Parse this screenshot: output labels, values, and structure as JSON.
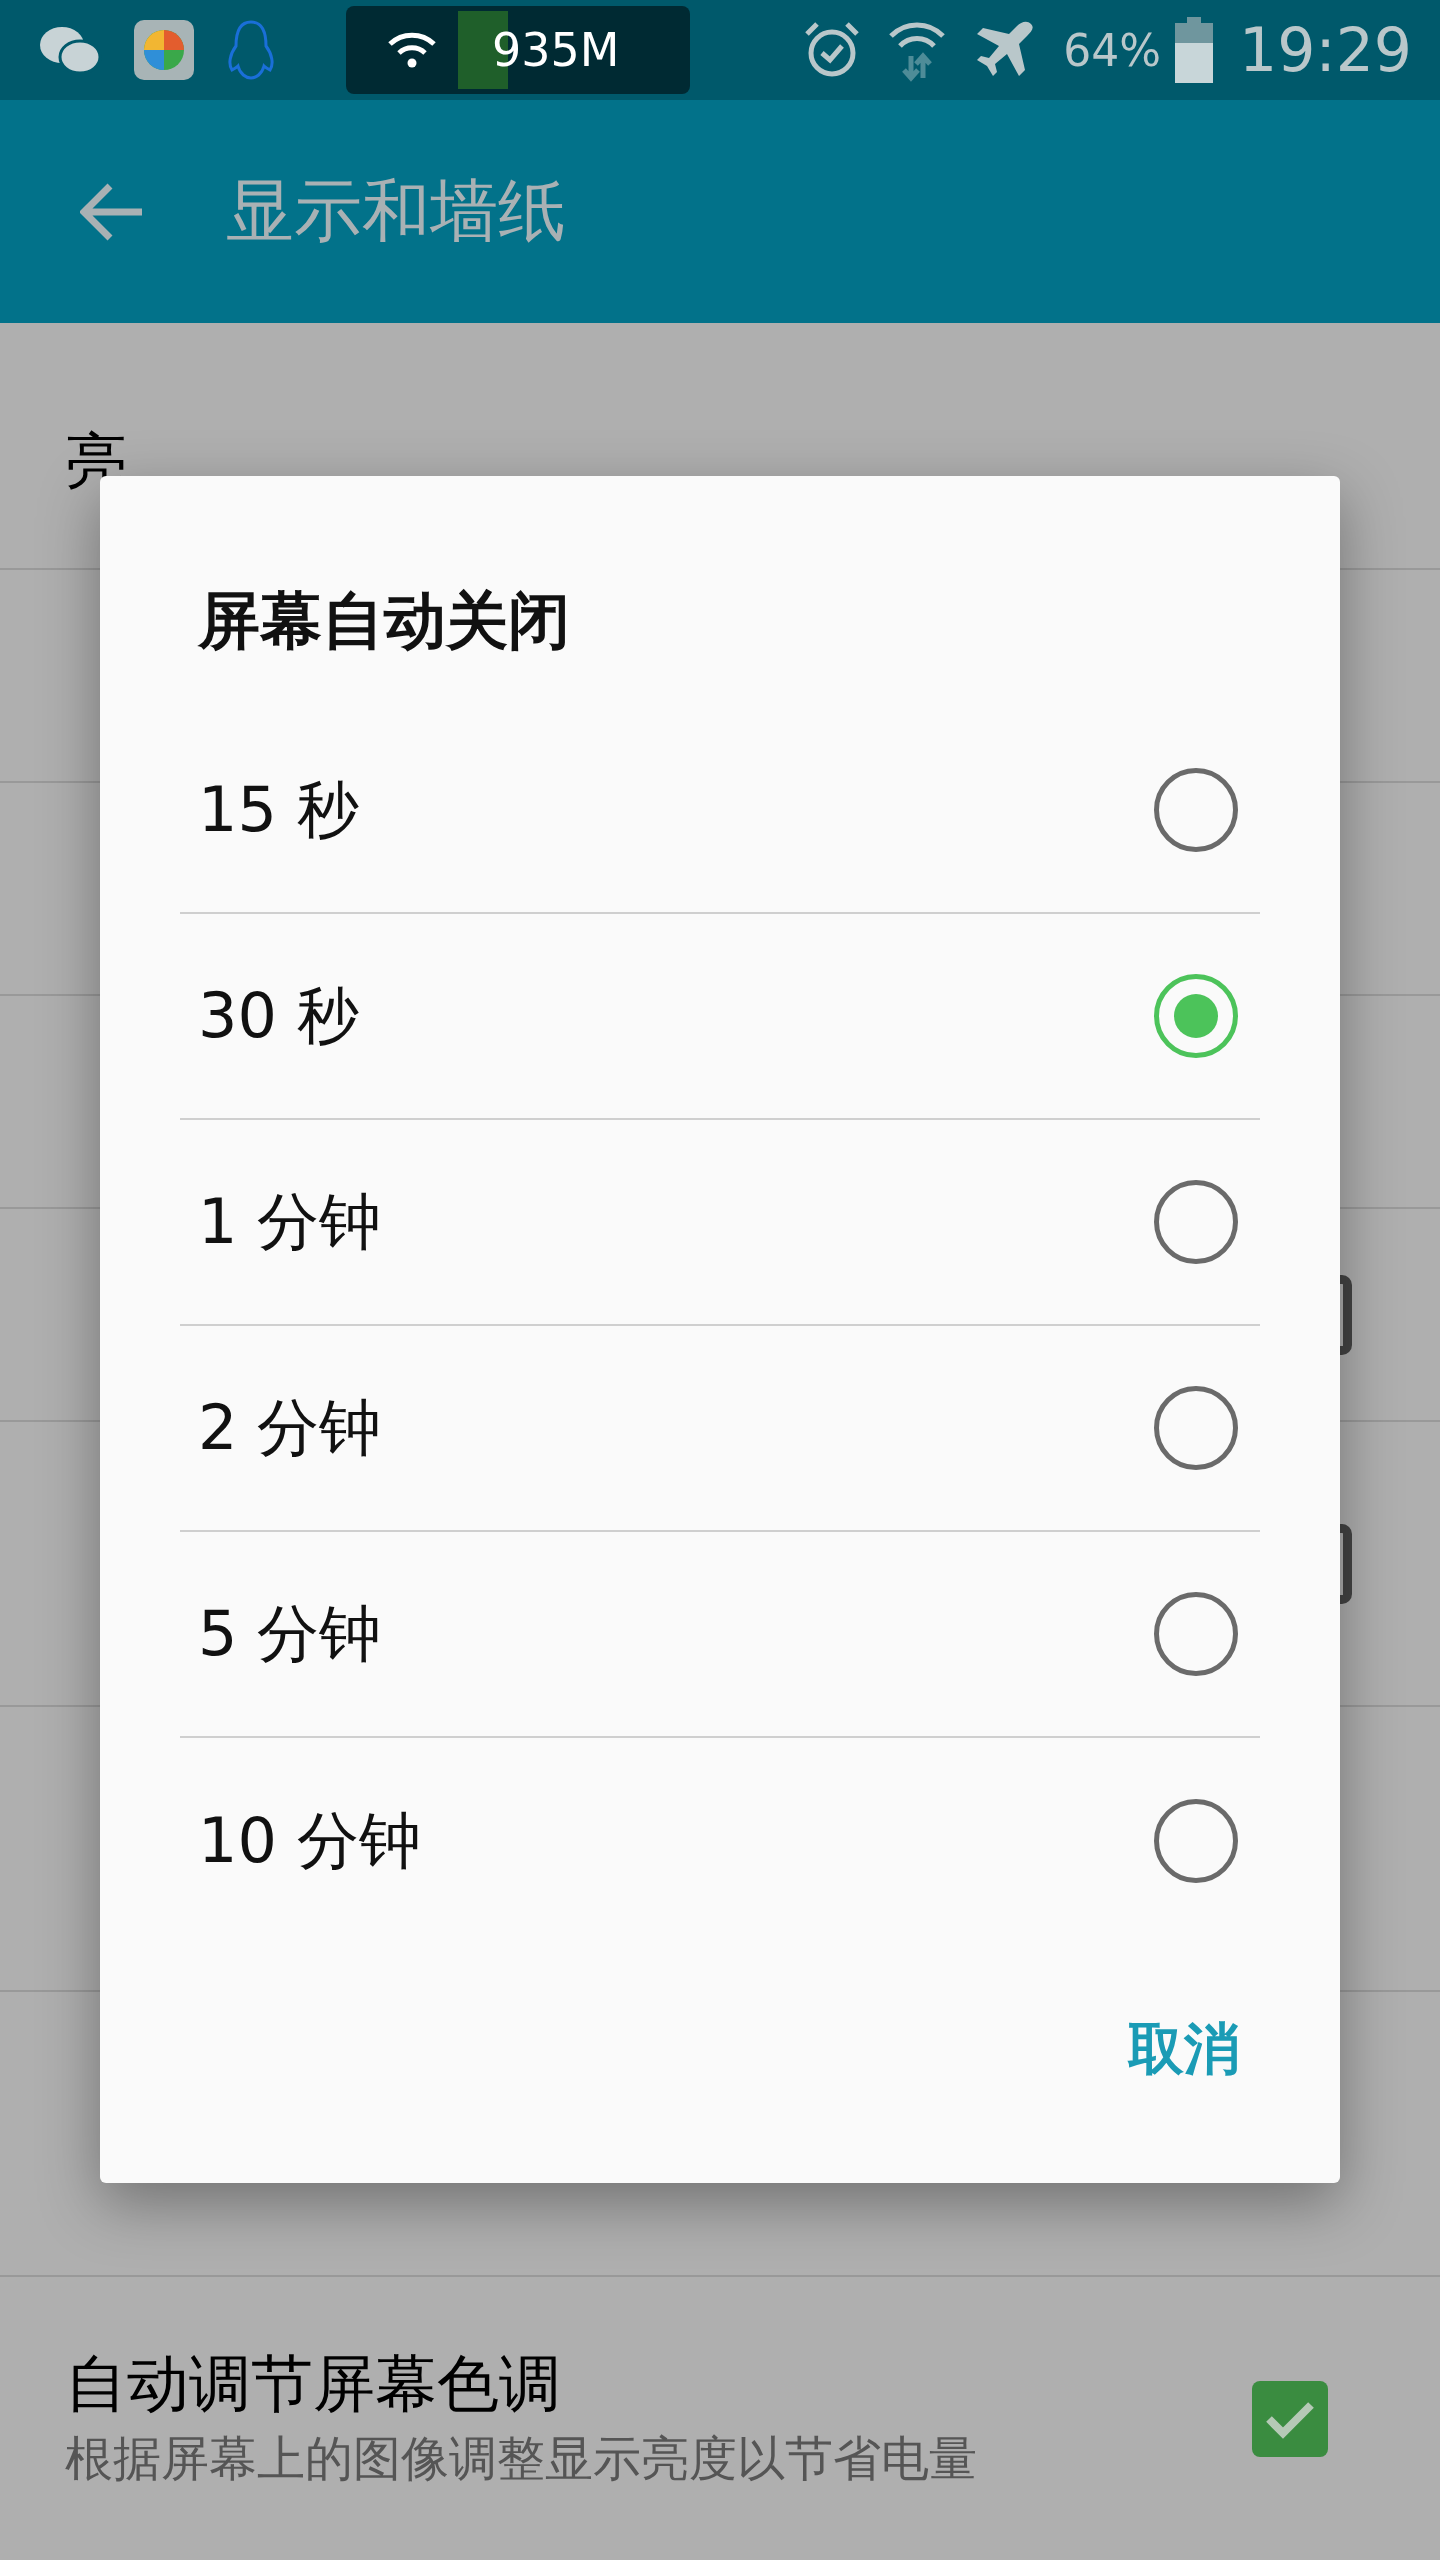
{
  "status_bar": {
    "network_speed": "935M",
    "battery": "64%",
    "time": "19:29"
  },
  "app_bar": {
    "title": "显示和墙纸"
  },
  "settings": [
    {
      "kind": "text",
      "title": "亮"
    },
    {
      "kind": "covered"
    },
    {
      "kind": "covered"
    },
    {
      "kind": "covered"
    },
    {
      "kind": "covered_checkbox"
    },
    {
      "kind": "covered_tall_checkbox"
    },
    {
      "kind": "covered_tall"
    },
    {
      "kind": "covered_tall"
    },
    {
      "kind": "checkbox",
      "title": "自动调节屏幕色调",
      "subtitle": "根据屏幕上的图像调整显示亮度以节省电量",
      "checked": true
    }
  ],
  "dialog": {
    "title": "屏幕自动关闭",
    "options": [
      {
        "label": "15 秒",
        "selected": false
      },
      {
        "label": "30 秒",
        "selected": true
      },
      {
        "label": "1 分钟",
        "selected": false
      },
      {
        "label": "2 分钟",
        "selected": false
      },
      {
        "label": "5 分钟",
        "selected": false
      },
      {
        "label": "10 分钟",
        "selected": false
      }
    ],
    "buttons": [
      "取消"
    ]
  }
}
